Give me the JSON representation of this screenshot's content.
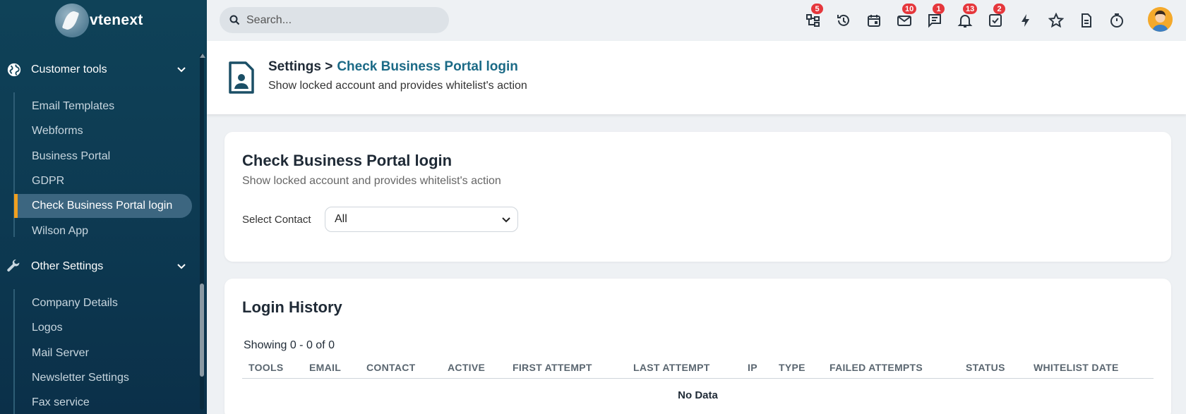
{
  "app": {
    "logo_text": "vtenext"
  },
  "search": {
    "placeholder": "Search..."
  },
  "topbar": {
    "icons": [
      {
        "name": "hierarchy-icon",
        "badge": "5"
      },
      {
        "name": "history-icon",
        "badge": ""
      },
      {
        "name": "calendar-icon",
        "badge": ""
      },
      {
        "name": "mail-icon",
        "badge": "10"
      },
      {
        "name": "chat-icon",
        "badge": "1"
      },
      {
        "name": "bell-icon",
        "badge": "13"
      },
      {
        "name": "task-check-icon",
        "badge": "2"
      },
      {
        "name": "lightning-icon",
        "badge": ""
      },
      {
        "name": "star-icon",
        "badge": ""
      },
      {
        "name": "document-icon",
        "badge": ""
      },
      {
        "name": "timer-icon",
        "badge": ""
      }
    ],
    "badge_color": "#e5373c"
  },
  "sidebar": {
    "sections": [
      {
        "label": "Customer tools",
        "icon": "globe-icon"
      },
      {
        "label": "Other Settings",
        "icon": "wrench-icon"
      }
    ],
    "customer_items": [
      {
        "label": "Email Templates"
      },
      {
        "label": "Webforms"
      },
      {
        "label": "Business Portal"
      },
      {
        "label": "GDPR"
      },
      {
        "label": "Check Business Portal login"
      },
      {
        "label": "Wilson App"
      }
    ],
    "other_items": [
      {
        "label": "Company Details"
      },
      {
        "label": "Logos"
      },
      {
        "label": "Mail Server"
      },
      {
        "label": "Newsletter Settings"
      },
      {
        "label": "Fax service"
      }
    ],
    "active_color": "#f0a020"
  },
  "header": {
    "breadcrumb_parent": "Settings >",
    "breadcrumb_current": "Check Business Portal login",
    "subtitle": "Show locked account and provides whitelist's action"
  },
  "filter_card": {
    "title": "Check Business Portal login",
    "subtitle": "Show locked account and provides whitelist's action",
    "select_label": "Select Contact",
    "select_value": "All"
  },
  "history_card": {
    "title": "Login History",
    "showing": "Showing 0 - 0 of 0",
    "columns": [
      "TOOLS",
      "EMAIL",
      "CONTACT",
      "ACTIVE",
      "FIRST ATTEMPT",
      "LAST ATTEMPT",
      "IP",
      "TYPE",
      "FAILED ATTEMPTS",
      "STATUS",
      "WHITELIST DATE"
    ],
    "empty_text": "No Data"
  }
}
